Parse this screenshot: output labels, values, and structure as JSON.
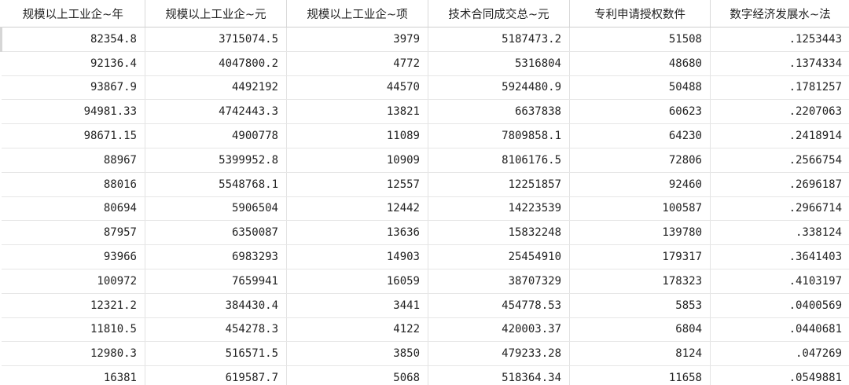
{
  "columns": [
    "规模以上工业企~年",
    "规模以上工业企~元",
    "规模以上工业企~项",
    "技术合同成交总~元",
    "专利申请授权数件",
    "数字经济发展水~法"
  ],
  "rows": [
    [
      "82354.8",
      "3715074.5",
      "3979",
      "5187473.2",
      "51508",
      ".1253443"
    ],
    [
      "92136.4",
      "4047800.2",
      "4772",
      "5316804",
      "48680",
      ".1374334"
    ],
    [
      "93867.9",
      "4492192",
      "44570",
      "5924480.9",
      "50488",
      ".1781257"
    ],
    [
      "94981.33",
      "4742443.3",
      "13821",
      "6637838",
      "60623",
      ".2207063"
    ],
    [
      "98671.15",
      "4900778",
      "11089",
      "7809858.1",
      "64230",
      ".2418914"
    ],
    [
      "88967",
      "5399952.8",
      "10909",
      "8106176.5",
      "72806",
      ".2566754"
    ],
    [
      "88016",
      "5548768.1",
      "12557",
      "12251857",
      "92460",
      ".2696187"
    ],
    [
      "80694",
      "5906504",
      "12442",
      "14223539",
      "100587",
      ".2966714"
    ],
    [
      "87957",
      "6350087",
      "13636",
      "15832248",
      "139780",
      ".338124"
    ],
    [
      "93966",
      "6983293",
      "14903",
      "25454910",
      "179317",
      ".3641403"
    ],
    [
      "100972",
      "7659941",
      "16059",
      "38707329",
      "178323",
      ".4103197"
    ],
    [
      "12321.2",
      "384430.4",
      "3441",
      "454778.53",
      "5853",
      ".0400569"
    ],
    [
      "11810.5",
      "454278.3",
      "4122",
      "420003.37",
      "6804",
      ".0440681"
    ],
    [
      "12980.3",
      "516571.5",
      "3850",
      "479233.28",
      "8124",
      ".047269"
    ],
    [
      "16381",
      "619587.7",
      "5068",
      "518364.34",
      "11658",
      ".0549881"
    ]
  ]
}
